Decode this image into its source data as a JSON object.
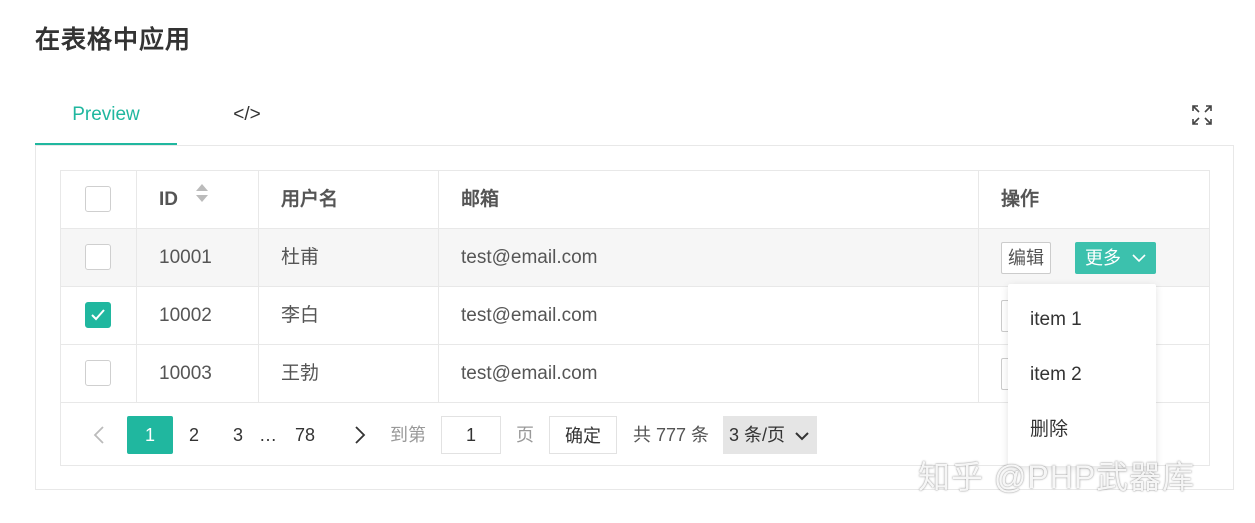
{
  "page": {
    "title": "在表格中应用"
  },
  "tabs": [
    {
      "label": "Preview",
      "active": true
    },
    {
      "label": "</>",
      "active": false
    }
  ],
  "table": {
    "columns": {
      "id": "ID",
      "username": "用户名",
      "email": "邮箱",
      "actions": "操作"
    },
    "rows": [
      {
        "id": "10001",
        "username": "杜甫",
        "email": "test@email.com",
        "checked": false
      },
      {
        "id": "10002",
        "username": "李白",
        "email": "test@email.com",
        "checked": true
      },
      {
        "id": "10003",
        "username": "王勃",
        "email": "test@email.com",
        "checked": false
      }
    ],
    "edit_label": "编辑",
    "more_label": "更多"
  },
  "dropdown": {
    "items": [
      "item 1",
      "item 2",
      "删除"
    ]
  },
  "pagination": {
    "pages": [
      "1",
      "2",
      "3",
      "78"
    ],
    "ellipsis": "…",
    "current": "1",
    "goto_label": "到第",
    "goto_value": "1",
    "page_suffix": "页",
    "confirm_label": "确定",
    "total_label": "共 777 条",
    "page_size_label": "3 条/页"
  },
  "watermark": "知乎 @PHP武器库",
  "colors": {
    "accent": "#20b79f",
    "more_button": "#3cc1ad"
  }
}
